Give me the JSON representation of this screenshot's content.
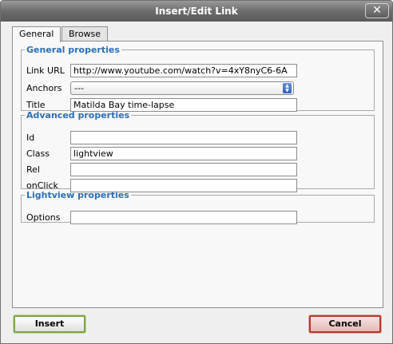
{
  "window": {
    "title": "Insert/Edit Link",
    "close_glyph": "✕"
  },
  "tabs": [
    {
      "label": "General",
      "active": true
    },
    {
      "label": "Browse",
      "active": false
    }
  ],
  "general": {
    "legend": "General properties",
    "link_url_label": "Link URL",
    "link_url_value": "http://www.youtube.com/watch?v=4xY8nyC6-6A",
    "anchors_label": "Anchors",
    "anchors_value": "---",
    "title_label": "Title",
    "title_value": "Matilda Bay time-lapse"
  },
  "advanced": {
    "legend": "Advanced properties",
    "id_label": "Id",
    "id_value": "",
    "class_label": "Class",
    "class_value": "lightview",
    "rel_label": "Rel",
    "rel_value": "",
    "onclick_label": "onClick",
    "onclick_value": ""
  },
  "lightview": {
    "legend": "Lightview properties",
    "options_label": "Options",
    "options_value": ""
  },
  "buttons": {
    "insert": "Insert",
    "cancel": "Cancel"
  },
  "icons": {
    "close": "close-icon",
    "select_arrows": "select-arrows-icon"
  }
}
